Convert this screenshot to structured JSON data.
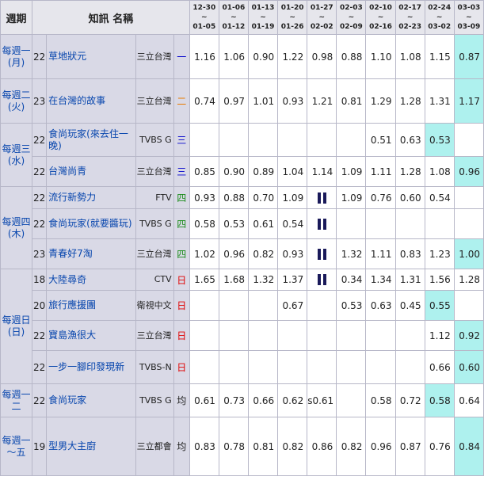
{
  "header": {
    "day_label": "週期",
    "name_label": "知訊 名稱",
    "weeks": [
      [
        "12-30",
        "~",
        "01-05"
      ],
      [
        "01-06",
        "~",
        "01-12"
      ],
      [
        "01-13",
        "~",
        "01-19"
      ],
      [
        "01-20",
        "~",
        "01-26"
      ],
      [
        "01-27",
        "~",
        "02-02"
      ],
      [
        "02-03",
        "~",
        "02-09"
      ],
      [
        "02-10",
        "~",
        "02-16"
      ],
      [
        "02-17",
        "~",
        "02-23"
      ],
      [
        "02-24",
        "~",
        "03-02"
      ],
      [
        "03-03",
        "~",
        "03-09"
      ]
    ]
  },
  "groups": [
    {
      "day": "每週一(月)"
    },
    {
      "day": "每週二(火)"
    },
    {
      "day": "每週三(水)"
    },
    {
      "day": "每週四(木)"
    },
    {
      "day": "每週日(日)"
    },
    {
      "day": "每週一二"
    },
    {
      "day": "每週一～五"
    }
  ],
  "rows": [
    {
      "time": "22",
      "name": "草地狀元",
      "net": "三立台灣",
      "wd": "一",
      "cells": [
        "1.16",
        "1.06",
        "0.90",
        "1.22",
        "0.98",
        "0.88",
        "1.10",
        "1.08",
        "1.15",
        "0.87"
      ]
    },
    {
      "time": "23",
      "name": "在台灣的故事",
      "net": "三立台灣",
      "wd": "二",
      "cells": [
        "0.74",
        "0.97",
        "1.01",
        "0.93",
        "1.21",
        "0.81",
        "1.29",
        "1.28",
        "1.31",
        "1.17"
      ]
    },
    {
      "time": "22",
      "name": "食尚玩家(來去住一晚)",
      "net": "TVBS G",
      "wd": "三",
      "cells": [
        "",
        "",
        "",
        "",
        "",
        "",
        "0.51",
        "0.63",
        "0.53",
        ""
      ]
    },
    {
      "time": "22",
      "name": "台灣尚青",
      "net": "三立台灣",
      "wd": "三",
      "cells": [
        "0.85",
        "0.90",
        "0.89",
        "1.04",
        "1.14",
        "1.09",
        "1.11",
        "1.28",
        "1.08",
        "0.96"
      ]
    },
    {
      "time": "22",
      "name": "流行新勢力",
      "net": "FTV",
      "wd": "四",
      "cells": [
        "0.93",
        "0.88",
        "0.70",
        "1.09",
        "",
        "1.09",
        "0.76",
        "0.60",
        "0.54",
        ""
      ]
    },
    {
      "time": "22",
      "name": "食尚玩家(就要醬玩)",
      "net": "TVBS G",
      "wd": "四",
      "cells": [
        "0.58",
        "0.53",
        "0.61",
        "0.54",
        "",
        "",
        "",
        "",
        "",
        ""
      ]
    },
    {
      "time": "23",
      "name": "青春好7淘",
      "net": "三立台灣",
      "wd": "四",
      "cells": [
        "1.02",
        "0.96",
        "0.82",
        "0.93",
        "",
        "1.32",
        "1.11",
        "0.83",
        "1.23",
        "1.00"
      ]
    },
    {
      "time": "18",
      "name": "大陸尋奇",
      "net": "CTV",
      "wd": "日",
      "cells": [
        "1.65",
        "1.68",
        "1.32",
        "1.37",
        "",
        "0.34",
        "1.34",
        "1.31",
        "1.56",
        "1.28"
      ]
    },
    {
      "time": "20",
      "name": "旅行應援團",
      "net": "衛視中文",
      "wd": "日",
      "cells": [
        "",
        "",
        "",
        "0.67",
        "",
        "0.53",
        "0.63",
        "0.45",
        "0.55",
        ""
      ]
    },
    {
      "time": "22",
      "name": "寶島漁很大",
      "net": "三立台灣",
      "wd": "日",
      "cells": [
        "",
        "",
        "",
        "",
        "",
        "",
        "",
        "",
        "1.12",
        "0.92"
      ]
    },
    {
      "time": "22",
      "name": "一步一腳印發現新",
      "net": "TVBS-N",
      "wd": "日",
      "cells": [
        "",
        "",
        "",
        "",
        "",
        "",
        "",
        "",
        "0.66",
        "0.60"
      ]
    },
    {
      "time": "22",
      "name": "食尚玩家",
      "net": "TVBS G",
      "wd": "均",
      "cells": [
        "0.61",
        "0.73",
        "0.66",
        "0.62",
        "s0.61",
        "",
        "0.58",
        "0.72",
        "0.58",
        "0.64"
      ]
    },
    {
      "time": "19",
      "name": "型男大主廚",
      "net": "三立都會",
      "wd": "均",
      "cells": [
        "0.83",
        "0.78",
        "0.81",
        "0.82",
        "0.86",
        "0.82",
        "0.96",
        "0.87",
        "0.76",
        "0.84"
      ]
    }
  ],
  "colors": {
    "highlight": "#aef1ee",
    "side": "#d9d9e6",
    "link": "#0645ad"
  }
}
